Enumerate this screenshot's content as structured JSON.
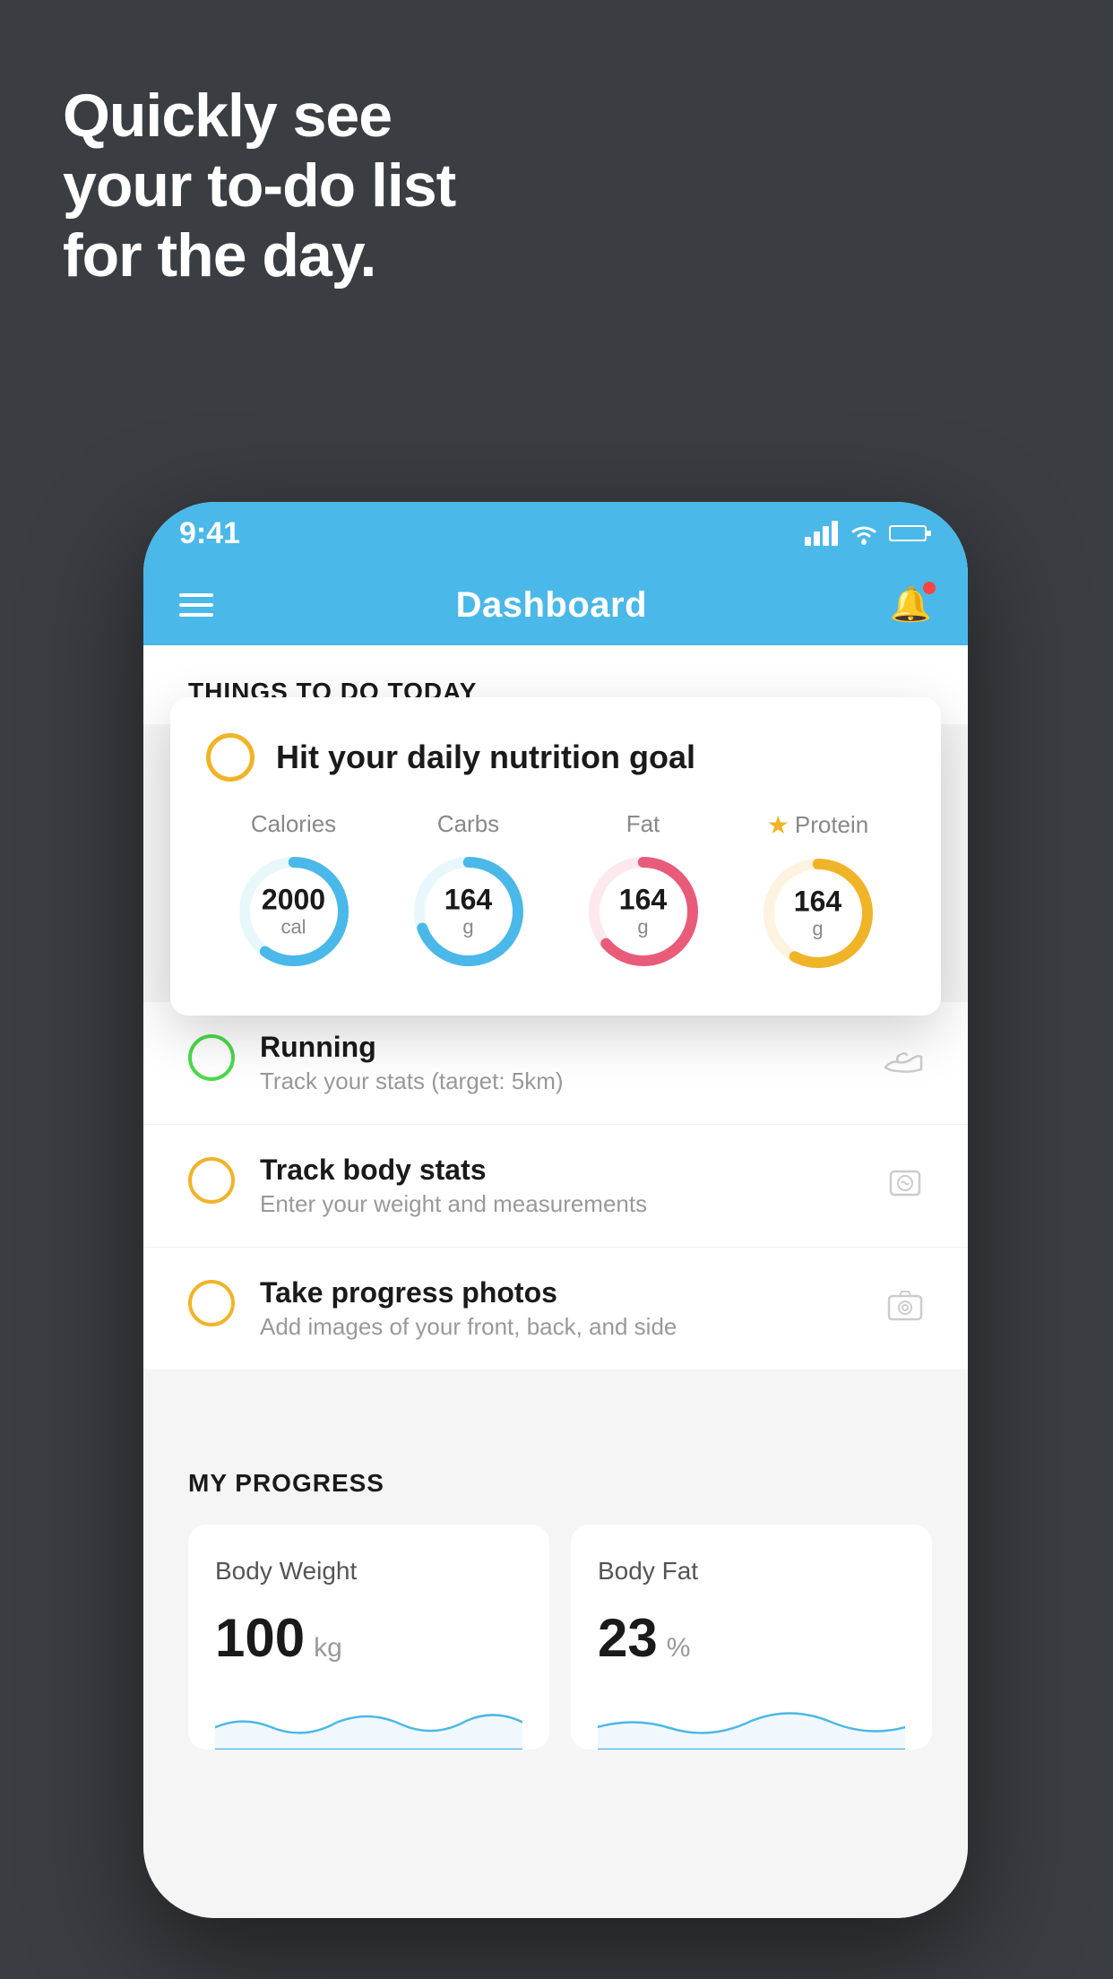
{
  "hero": {
    "line1": "Quickly see",
    "line2": "your to-do list",
    "line3": "for the day."
  },
  "status_bar": {
    "time": "9:41",
    "signal_icon": "signal-icon",
    "wifi_icon": "wifi-icon",
    "battery_icon": "battery-icon"
  },
  "nav": {
    "title": "Dashboard",
    "menu_icon": "hamburger-icon",
    "bell_icon": "bell-icon"
  },
  "things_today": {
    "header": "THINGS TO DO TODAY"
  },
  "nutrition_card": {
    "title": "Hit your daily nutrition goal",
    "items": [
      {
        "label": "Calories",
        "value": "2000",
        "unit": "cal",
        "color": "#4ab8e8",
        "starred": false
      },
      {
        "label": "Carbs",
        "value": "164",
        "unit": "g",
        "color": "#4ab8e8",
        "starred": false
      },
      {
        "label": "Fat",
        "value": "164",
        "unit": "g",
        "color": "#e85c7a",
        "starred": false
      },
      {
        "label": "Protein",
        "value": "164",
        "unit": "g",
        "color": "#f0b429",
        "starred": true
      }
    ]
  },
  "todo_items": [
    {
      "title": "Running",
      "subtitle": "Track your stats (target: 5km)",
      "circle_color": "green",
      "icon": "shoe-icon"
    },
    {
      "title": "Track body stats",
      "subtitle": "Enter your weight and measurements",
      "circle_color": "yellow",
      "icon": "scale-icon"
    },
    {
      "title": "Take progress photos",
      "subtitle": "Add images of your front, back, and side",
      "circle_color": "yellow",
      "icon": "photo-icon"
    }
  ],
  "progress": {
    "header": "MY PROGRESS",
    "cards": [
      {
        "title": "Body Weight",
        "value": "100",
        "unit": "kg"
      },
      {
        "title": "Body Fat",
        "value": "23",
        "unit": "%"
      }
    ]
  }
}
